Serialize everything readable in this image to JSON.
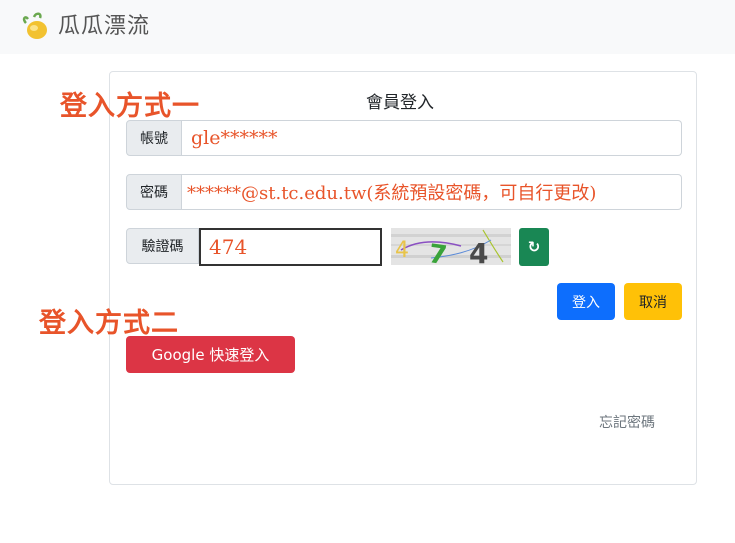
{
  "header": {
    "brand": "瓜瓜漂流",
    "logo_icon": "melon-logo-icon"
  },
  "login": {
    "title": "會員登入",
    "account_label": "帳號",
    "account_value": "gle******",
    "password_label": "密碼",
    "password_value": "******@st.tc.edu.tw(系統預設密碼，可自行更改)",
    "captcha_label": "驗證碼",
    "captcha_value": "474",
    "captcha_image_text": [
      "4",
      "7",
      "4"
    ],
    "refresh_icon": "↻",
    "login_button": "登入",
    "cancel_button": "取消",
    "google_button": "Google 快速登入",
    "forgot_link": "忘記密碼"
  },
  "annotations": {
    "method1": "登入方式一",
    "method2": "登入方式二"
  },
  "colors": {
    "annotation": "#e8542a",
    "primary": "#0d6efd",
    "warning": "#ffc107",
    "danger": "#dc3545",
    "success": "#198754"
  }
}
